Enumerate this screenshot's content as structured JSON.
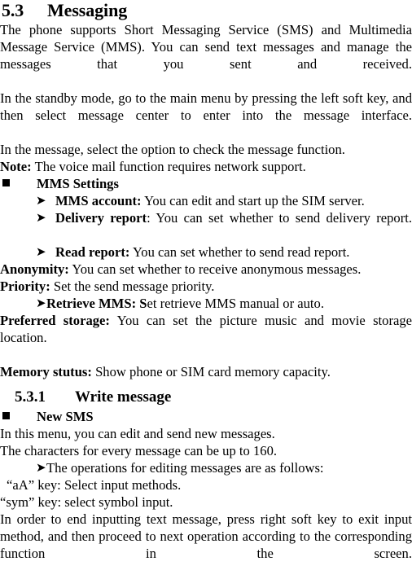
{
  "document": {
    "section": {
      "number": "5.3",
      "title": "Messaging"
    },
    "intro_paragraphs": [
      "The phone supports Short Messaging Service (SMS) and Multimedia Message Service (MMS). You can send text messages and manage the messages that you sent and received.",
      "In the standby mode, go to the main menu by pressing the left soft key, and then select message center to enter into the message interface.",
      "In the message, select the option to check the message function."
    ],
    "note": {
      "label": "Note:",
      "text": "The voice mail function requires network support."
    },
    "mms_settings": {
      "bullet": "square-bullet",
      "heading": "MMS Settings",
      "items": [
        {
          "bullet": "arrow-bullet",
          "term": "MMS account:",
          "description": "You can edit and start up the SIM server."
        },
        {
          "bullet": "arrow-bullet",
          "term": "Delivery report",
          "term_suffix": ":",
          "description": "You can set whether to send delivery report."
        },
        {
          "bullet": "arrow-bullet",
          "term": "Read report:",
          "description": "You can set whether to send read report."
        }
      ]
    },
    "settings_entries": [
      {
        "term": "Anonymity:",
        "description": "You can set whether to receive anonymous messages."
      },
      {
        "term": "Priority:",
        "description": "Set the send message priority."
      }
    ],
    "retrieve_mms": {
      "bullet": "arrow-bullet",
      "term": "Retrieve MMS: S",
      "description": "et retrieve MMS manual or auto."
    },
    "storage_entries": [
      {
        "term": "Preferred storage:",
        "description": "You can set the picture music and movie storage location."
      },
      {
        "term": "Memory stutus:",
        "description": "Show phone or SIM card memory capacity."
      }
    ],
    "subsection": {
      "number": "5.3.1",
      "title": "Write message"
    },
    "new_sms": {
      "bullet": "square-bullet",
      "heading": "New SMS",
      "paragraphs": [
        "In this menu, you can edit and send new messages.",
        "The characters for every message can be up to 160."
      ],
      "operations_item": {
        "bullet": "arrow-bullet",
        "text": "The operations for editing messages are as follows:"
      },
      "key_lines": [
        "“aA” key: Select input methods.",
        "“sym” key: select symbol input."
      ],
      "closing_paragraph": "In order to end inputting text message, press right soft key to exit input method, and then proceed to next operation according to the corresponding function in the screen."
    }
  }
}
